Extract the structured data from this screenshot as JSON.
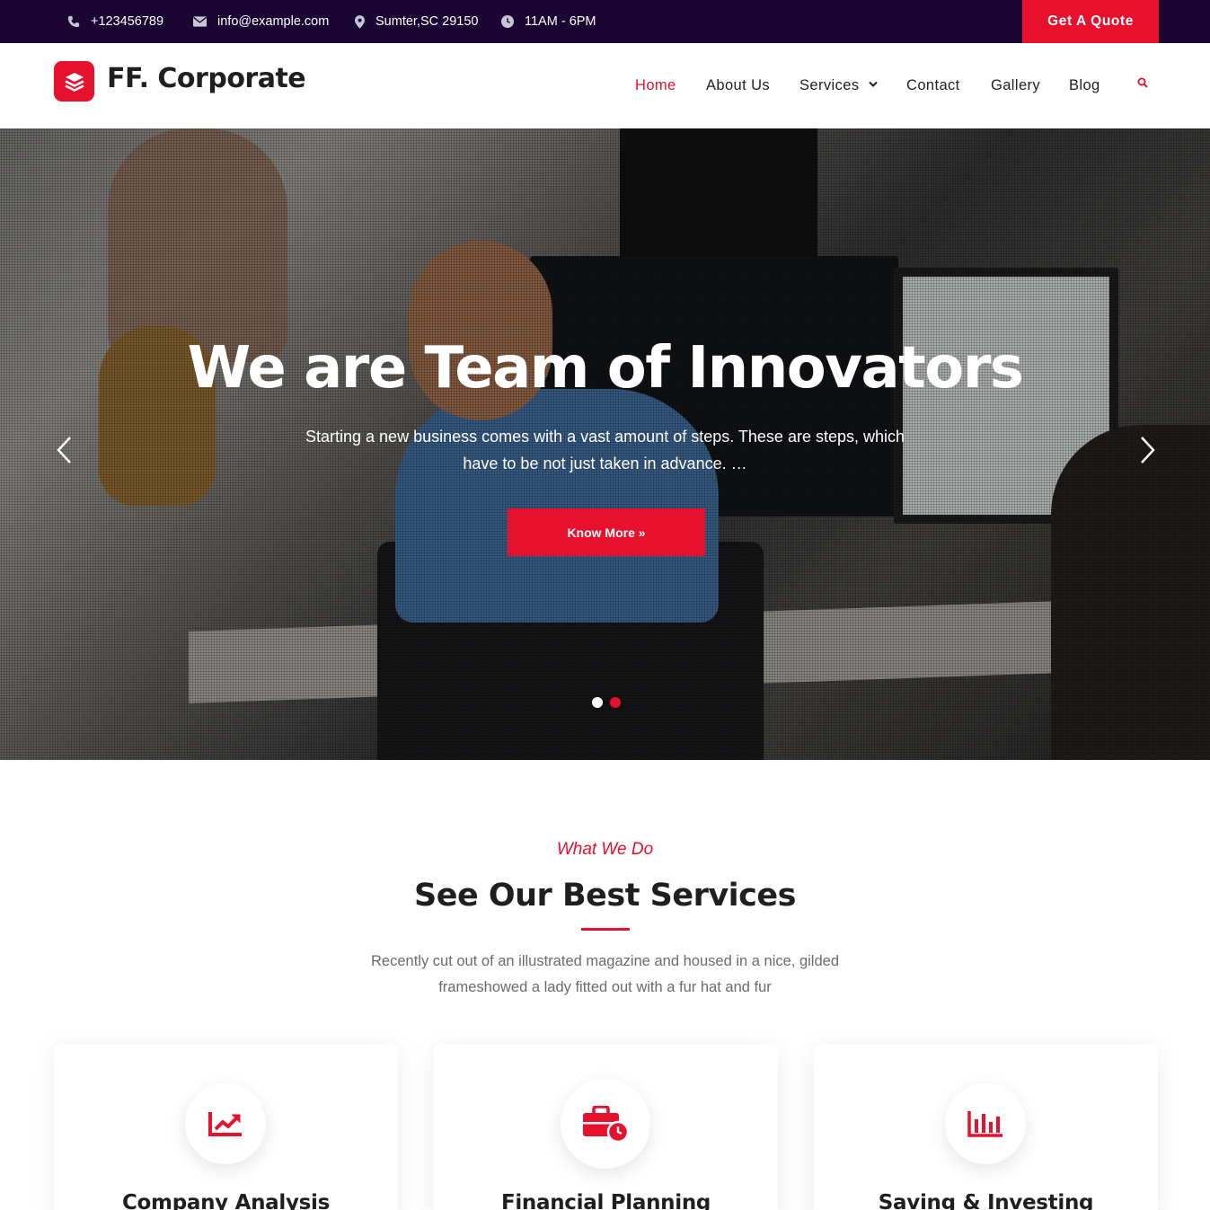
{
  "topbar": {
    "phone": "+123456789",
    "email": "info@example.com",
    "address": "Sumter,SC 29150",
    "hours": "11AM - 6PM",
    "quote_button": "Get A Quote"
  },
  "header": {
    "brand": "FF. Corporate",
    "nav": [
      "Home",
      "About Us",
      "Services",
      "Contact",
      "Gallery",
      "Blog"
    ],
    "active_nav": "Home"
  },
  "hero": {
    "title": "We are Team of Innovators",
    "subtitle": "Starting a new business comes with a vast amount of steps. These are steps, which have to be not just taken in advance. …",
    "button": "Know More »",
    "slides_total": 2,
    "active_slide": 2
  },
  "services": {
    "eyebrow": "What We Do",
    "title": "See Our Best Services",
    "description": "Recently cut out of an illustrated magazine and housed in a nice, gilded frameshowed a lady fitted out with a fur hat and fur",
    "cards": [
      {
        "title": "Company Analysis",
        "icon": "chart-line-icon"
      },
      {
        "title": "Financial Planning",
        "icon": "briefcase-clock-icon"
      },
      {
        "title": "Saving & Investing",
        "icon": "bar-chart-icon"
      }
    ]
  },
  "colors": {
    "accent": "#e8112d",
    "topbar": "#1a0533"
  }
}
